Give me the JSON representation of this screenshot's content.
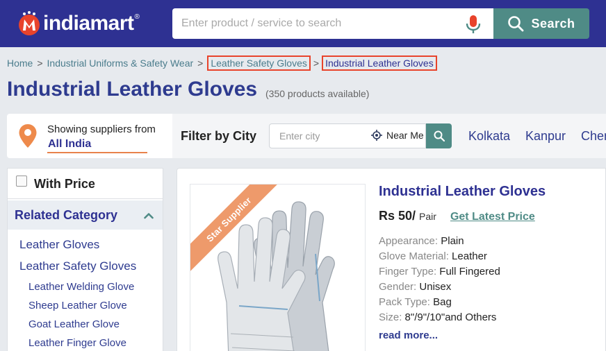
{
  "header": {
    "logo_text": "indiamart",
    "logo_reg": "®",
    "search_placeholder": "Enter product / service to search",
    "search_button": "Search"
  },
  "breadcrumb": [
    {
      "label": "Home"
    },
    {
      "label": "Industrial Uniforms & Safety Wear"
    },
    {
      "label": "Leather Safety Gloves"
    },
    {
      "label": "Industrial Leather Gloves"
    }
  ],
  "breadcrumb_sep": ">",
  "page": {
    "title": "Industrial Leather Gloves",
    "count": "(350 products available)"
  },
  "location": {
    "label": "Showing suppliers from",
    "value": "All India"
  },
  "filter": {
    "label": "Filter by City",
    "city_placeholder": "Enter city",
    "near_me": "Near Me",
    "cities": [
      "Kolkata",
      "Kanpur",
      "Chennai"
    ]
  },
  "sidebar": {
    "with_price": "With Price",
    "related_title": "Related Category",
    "categories": [
      {
        "label": "Leather Gloves"
      },
      {
        "label": "Leather Safety Gloves"
      },
      {
        "label": "Leather Welding Glove"
      },
      {
        "label": "Sheep Leather Glove"
      },
      {
        "label": "Goat Leather Glove"
      },
      {
        "label": "Leather Finger Glove"
      }
    ]
  },
  "product": {
    "badge": "Star Supplier",
    "title": "Industrial Leather Gloves",
    "price": "Rs 50/",
    "unit": "Pair",
    "latest_price": "Get Latest Price",
    "specs": [
      {
        "key": "Appearance",
        "value": "Plain"
      },
      {
        "key": "Glove Material",
        "value": "Leather"
      },
      {
        "key": "Finger Type",
        "value": "Full Fingered"
      },
      {
        "key": "Gender",
        "value": "Unisex"
      },
      {
        "key": "Pack Type",
        "value": "Bag"
      },
      {
        "key": "Size",
        "value": "8\"/9\"/10\"and Others"
      }
    ],
    "read_more": "read more..."
  },
  "colors": {
    "header_bg": "#2e3192",
    "accent_teal": "#4f8b86",
    "highlight_box": "#e8432b",
    "ribbon": "#ee9a6b"
  }
}
